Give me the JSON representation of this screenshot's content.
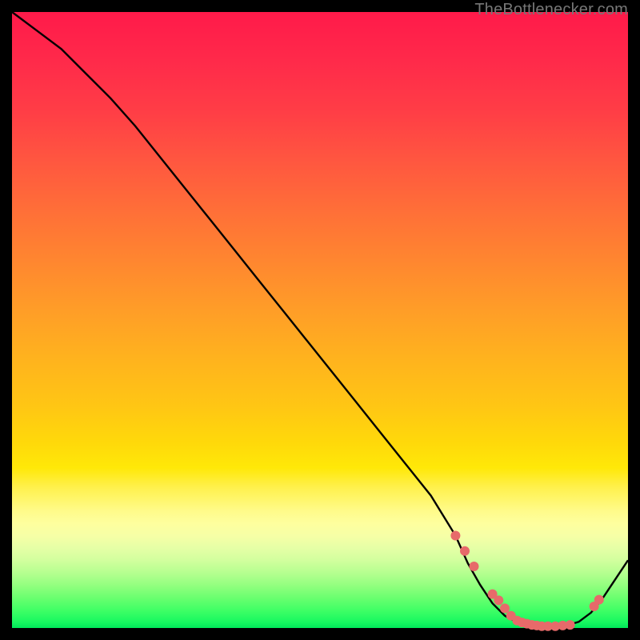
{
  "watermark": "TheBottlenecker.com",
  "colors": {
    "line": "#000000",
    "marker": "#e76a6a",
    "marker_stroke": "#c94f4f"
  },
  "chart_data": {
    "type": "line",
    "title": "",
    "xlabel": "",
    "ylabel": "",
    "xlim": [
      0,
      100
    ],
    "ylim": [
      0,
      100
    ],
    "series": [
      {
        "name": "curve",
        "x": [
          0,
          4,
          8,
          12,
          16,
          20,
          24,
          28,
          32,
          36,
          40,
          44,
          48,
          52,
          56,
          60,
          64,
          68,
          72,
          74,
          76,
          78,
          80,
          82,
          84,
          86,
          88,
          90,
          92,
          94,
          96,
          98,
          100
        ],
        "y": [
          100,
          97,
          94,
          90,
          86,
          81.5,
          76.5,
          71.5,
          66.5,
          61.5,
          56.5,
          51.5,
          46.5,
          41.5,
          36.5,
          31.5,
          26.5,
          21.5,
          15,
          10.5,
          7,
          4,
          2,
          0.9,
          0.4,
          0.2,
          0.2,
          0.4,
          1.0,
          2.5,
          5,
          8,
          11
        ]
      }
    ],
    "markers": {
      "name": "highlight-points",
      "x": [
        72,
        73.5,
        75,
        78,
        79,
        80,
        81,
        82,
        82.8,
        83.6,
        84.4,
        85.2,
        86,
        87,
        88.2,
        89.4,
        90.6,
        94.5,
        95.3
      ],
      "y": [
        15,
        12.5,
        10,
        5.5,
        4.5,
        3.2,
        2.0,
        1.2,
        0.9,
        0.7,
        0.5,
        0.4,
        0.3,
        0.3,
        0.3,
        0.4,
        0.5,
        3.5,
        4.6
      ]
    }
  }
}
